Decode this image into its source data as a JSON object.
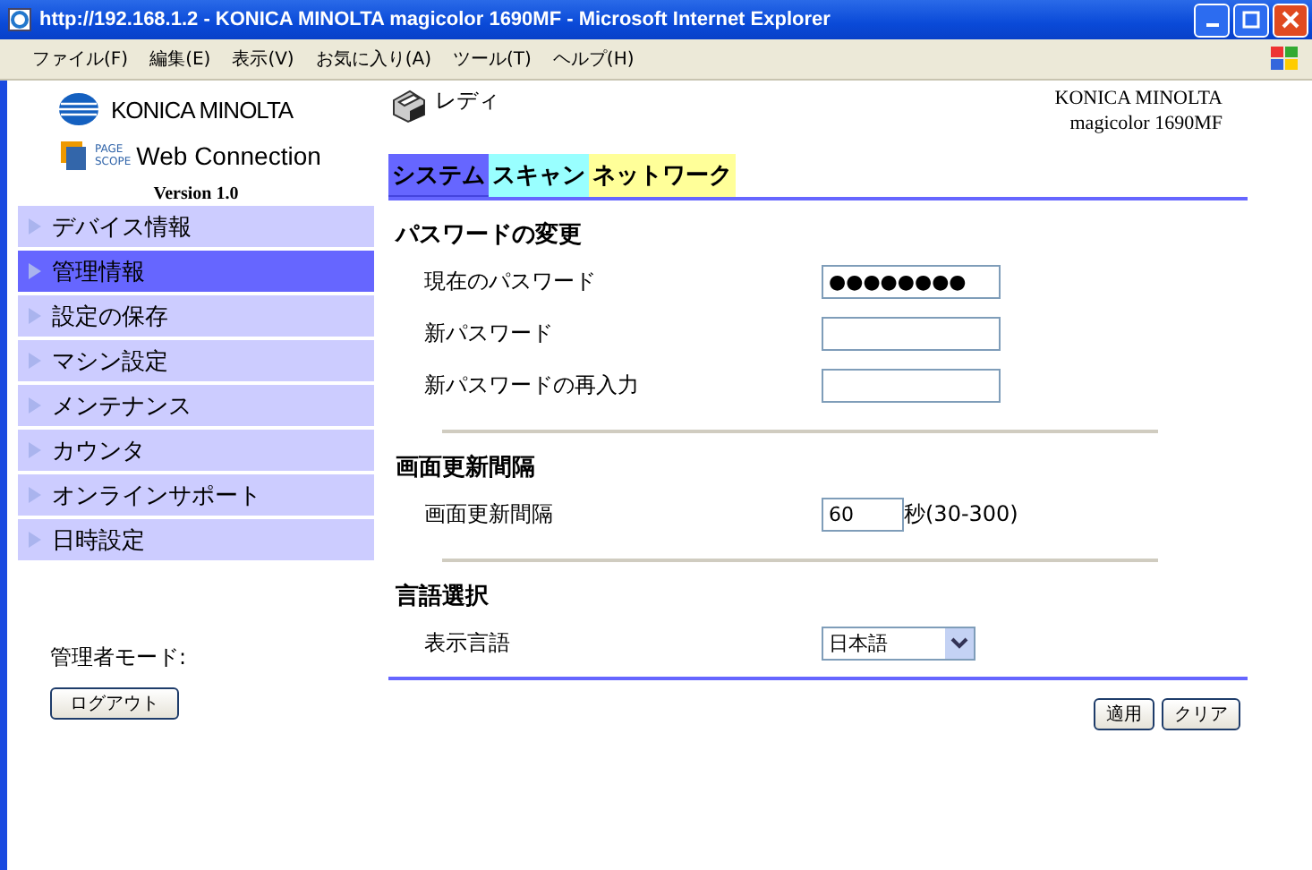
{
  "window": {
    "title": "http://192.168.1.2 - KONICA MINOLTA magicolor 1690MF - Microsoft Internet Explorer"
  },
  "menu": [
    "ファイル(F)",
    "編集(E)",
    "表示(V)",
    "お気に入り(A)",
    "ツール(T)",
    "ヘルプ(H)"
  ],
  "sidebar": {
    "logo": "KONICA MINOLTA",
    "product_small_1": "PAGE",
    "product_small_2": "SCOPE",
    "product": "Web Connection",
    "version": "Version 1.0",
    "items": [
      {
        "label": "デバイス情報",
        "selected": false
      },
      {
        "label": "管理情報",
        "selected": true
      },
      {
        "label": "設定の保存",
        "selected": false
      },
      {
        "label": "マシン設定",
        "selected": false
      },
      {
        "label": "メンテナンス",
        "selected": false
      },
      {
        "label": "カウンタ",
        "selected": false
      },
      {
        "label": "オンラインサポート",
        "selected": false
      },
      {
        "label": "日時設定",
        "selected": false
      }
    ],
    "mode_label": "管理者モード:",
    "logout": "ログアウト"
  },
  "header": {
    "status": "レディ",
    "brand": "KONICA MINOLTA",
    "model": "magicolor 1690MF"
  },
  "tabs": [
    {
      "label": "システム",
      "selected": true,
      "color": "#6666ff"
    },
    {
      "label": "スキャン",
      "selected": false,
      "color": "#99ffff"
    },
    {
      "label": "ネットワーク",
      "selected": false,
      "color": "#ffff99"
    }
  ],
  "sections": [
    {
      "title": "パスワードの変更",
      "fields": [
        {
          "label": "現在のパスワード",
          "kind": "password",
          "value": "●●●●●●●●"
        },
        {
          "label": "新パスワード",
          "kind": "password"
        },
        {
          "label": "新パスワードの再入力",
          "kind": "password"
        }
      ]
    },
    {
      "title": "画面更新間隔",
      "fields": [
        {
          "label": "画面更新間隔",
          "kind": "number",
          "value": "60",
          "suffix": "秒(30-300)"
        }
      ]
    },
    {
      "title": "言語選択",
      "fields": [
        {
          "label": "表示言語",
          "kind": "select",
          "value": "日本語"
        }
      ]
    }
  ],
  "buttons": [
    "適用",
    "クリア"
  ]
}
